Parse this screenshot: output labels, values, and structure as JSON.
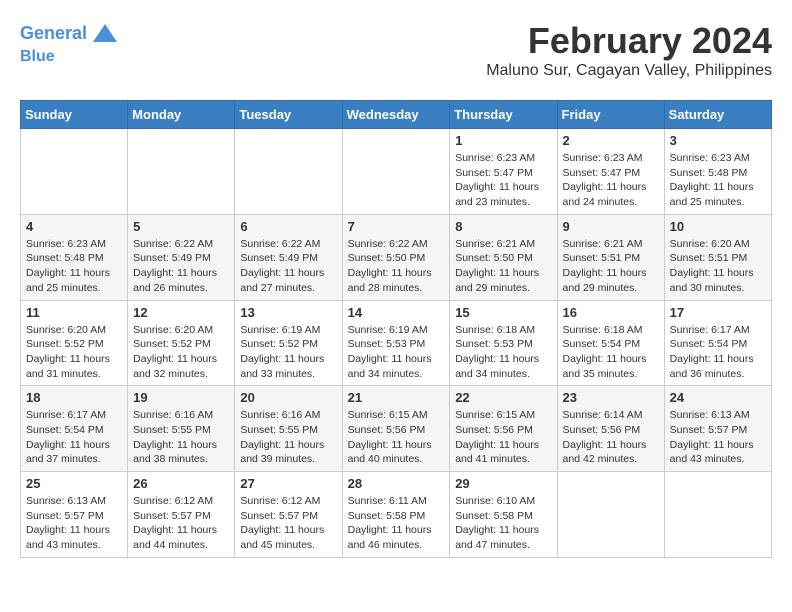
{
  "header": {
    "logo_line1": "General",
    "logo_line2": "Blue",
    "month_year": "February 2024",
    "location": "Maluno Sur, Cagayan Valley, Philippines"
  },
  "weekdays": [
    "Sunday",
    "Monday",
    "Tuesday",
    "Wednesday",
    "Thursday",
    "Friday",
    "Saturday"
  ],
  "weeks": [
    [
      {
        "day": "",
        "info": ""
      },
      {
        "day": "",
        "info": ""
      },
      {
        "day": "",
        "info": ""
      },
      {
        "day": "",
        "info": ""
      },
      {
        "day": "1",
        "info": "Sunrise: 6:23 AM\nSunset: 5:47 PM\nDaylight: 11 hours and 23 minutes."
      },
      {
        "day": "2",
        "info": "Sunrise: 6:23 AM\nSunset: 5:47 PM\nDaylight: 11 hours and 24 minutes."
      },
      {
        "day": "3",
        "info": "Sunrise: 6:23 AM\nSunset: 5:48 PM\nDaylight: 11 hours and 25 minutes."
      }
    ],
    [
      {
        "day": "4",
        "info": "Sunrise: 6:23 AM\nSunset: 5:48 PM\nDaylight: 11 hours and 25 minutes."
      },
      {
        "day": "5",
        "info": "Sunrise: 6:22 AM\nSunset: 5:49 PM\nDaylight: 11 hours and 26 minutes."
      },
      {
        "day": "6",
        "info": "Sunrise: 6:22 AM\nSunset: 5:49 PM\nDaylight: 11 hours and 27 minutes."
      },
      {
        "day": "7",
        "info": "Sunrise: 6:22 AM\nSunset: 5:50 PM\nDaylight: 11 hours and 28 minutes."
      },
      {
        "day": "8",
        "info": "Sunrise: 6:21 AM\nSunset: 5:50 PM\nDaylight: 11 hours and 29 minutes."
      },
      {
        "day": "9",
        "info": "Sunrise: 6:21 AM\nSunset: 5:51 PM\nDaylight: 11 hours and 29 minutes."
      },
      {
        "day": "10",
        "info": "Sunrise: 6:20 AM\nSunset: 5:51 PM\nDaylight: 11 hours and 30 minutes."
      }
    ],
    [
      {
        "day": "11",
        "info": "Sunrise: 6:20 AM\nSunset: 5:52 PM\nDaylight: 11 hours and 31 minutes."
      },
      {
        "day": "12",
        "info": "Sunrise: 6:20 AM\nSunset: 5:52 PM\nDaylight: 11 hours and 32 minutes."
      },
      {
        "day": "13",
        "info": "Sunrise: 6:19 AM\nSunset: 5:52 PM\nDaylight: 11 hours and 33 minutes."
      },
      {
        "day": "14",
        "info": "Sunrise: 6:19 AM\nSunset: 5:53 PM\nDaylight: 11 hours and 34 minutes."
      },
      {
        "day": "15",
        "info": "Sunrise: 6:18 AM\nSunset: 5:53 PM\nDaylight: 11 hours and 34 minutes."
      },
      {
        "day": "16",
        "info": "Sunrise: 6:18 AM\nSunset: 5:54 PM\nDaylight: 11 hours and 35 minutes."
      },
      {
        "day": "17",
        "info": "Sunrise: 6:17 AM\nSunset: 5:54 PM\nDaylight: 11 hours and 36 minutes."
      }
    ],
    [
      {
        "day": "18",
        "info": "Sunrise: 6:17 AM\nSunset: 5:54 PM\nDaylight: 11 hours and 37 minutes."
      },
      {
        "day": "19",
        "info": "Sunrise: 6:16 AM\nSunset: 5:55 PM\nDaylight: 11 hours and 38 minutes."
      },
      {
        "day": "20",
        "info": "Sunrise: 6:16 AM\nSunset: 5:55 PM\nDaylight: 11 hours and 39 minutes."
      },
      {
        "day": "21",
        "info": "Sunrise: 6:15 AM\nSunset: 5:56 PM\nDaylight: 11 hours and 40 minutes."
      },
      {
        "day": "22",
        "info": "Sunrise: 6:15 AM\nSunset: 5:56 PM\nDaylight: 11 hours and 41 minutes."
      },
      {
        "day": "23",
        "info": "Sunrise: 6:14 AM\nSunset: 5:56 PM\nDaylight: 11 hours and 42 minutes."
      },
      {
        "day": "24",
        "info": "Sunrise: 6:13 AM\nSunset: 5:57 PM\nDaylight: 11 hours and 43 minutes."
      }
    ],
    [
      {
        "day": "25",
        "info": "Sunrise: 6:13 AM\nSunset: 5:57 PM\nDaylight: 11 hours and 43 minutes."
      },
      {
        "day": "26",
        "info": "Sunrise: 6:12 AM\nSunset: 5:57 PM\nDaylight: 11 hours and 44 minutes."
      },
      {
        "day": "27",
        "info": "Sunrise: 6:12 AM\nSunset: 5:57 PM\nDaylight: 11 hours and 45 minutes."
      },
      {
        "day": "28",
        "info": "Sunrise: 6:11 AM\nSunset: 5:58 PM\nDaylight: 11 hours and 46 minutes."
      },
      {
        "day": "29",
        "info": "Sunrise: 6:10 AM\nSunset: 5:58 PM\nDaylight: 11 hours and 47 minutes."
      },
      {
        "day": "",
        "info": ""
      },
      {
        "day": "",
        "info": ""
      }
    ]
  ]
}
